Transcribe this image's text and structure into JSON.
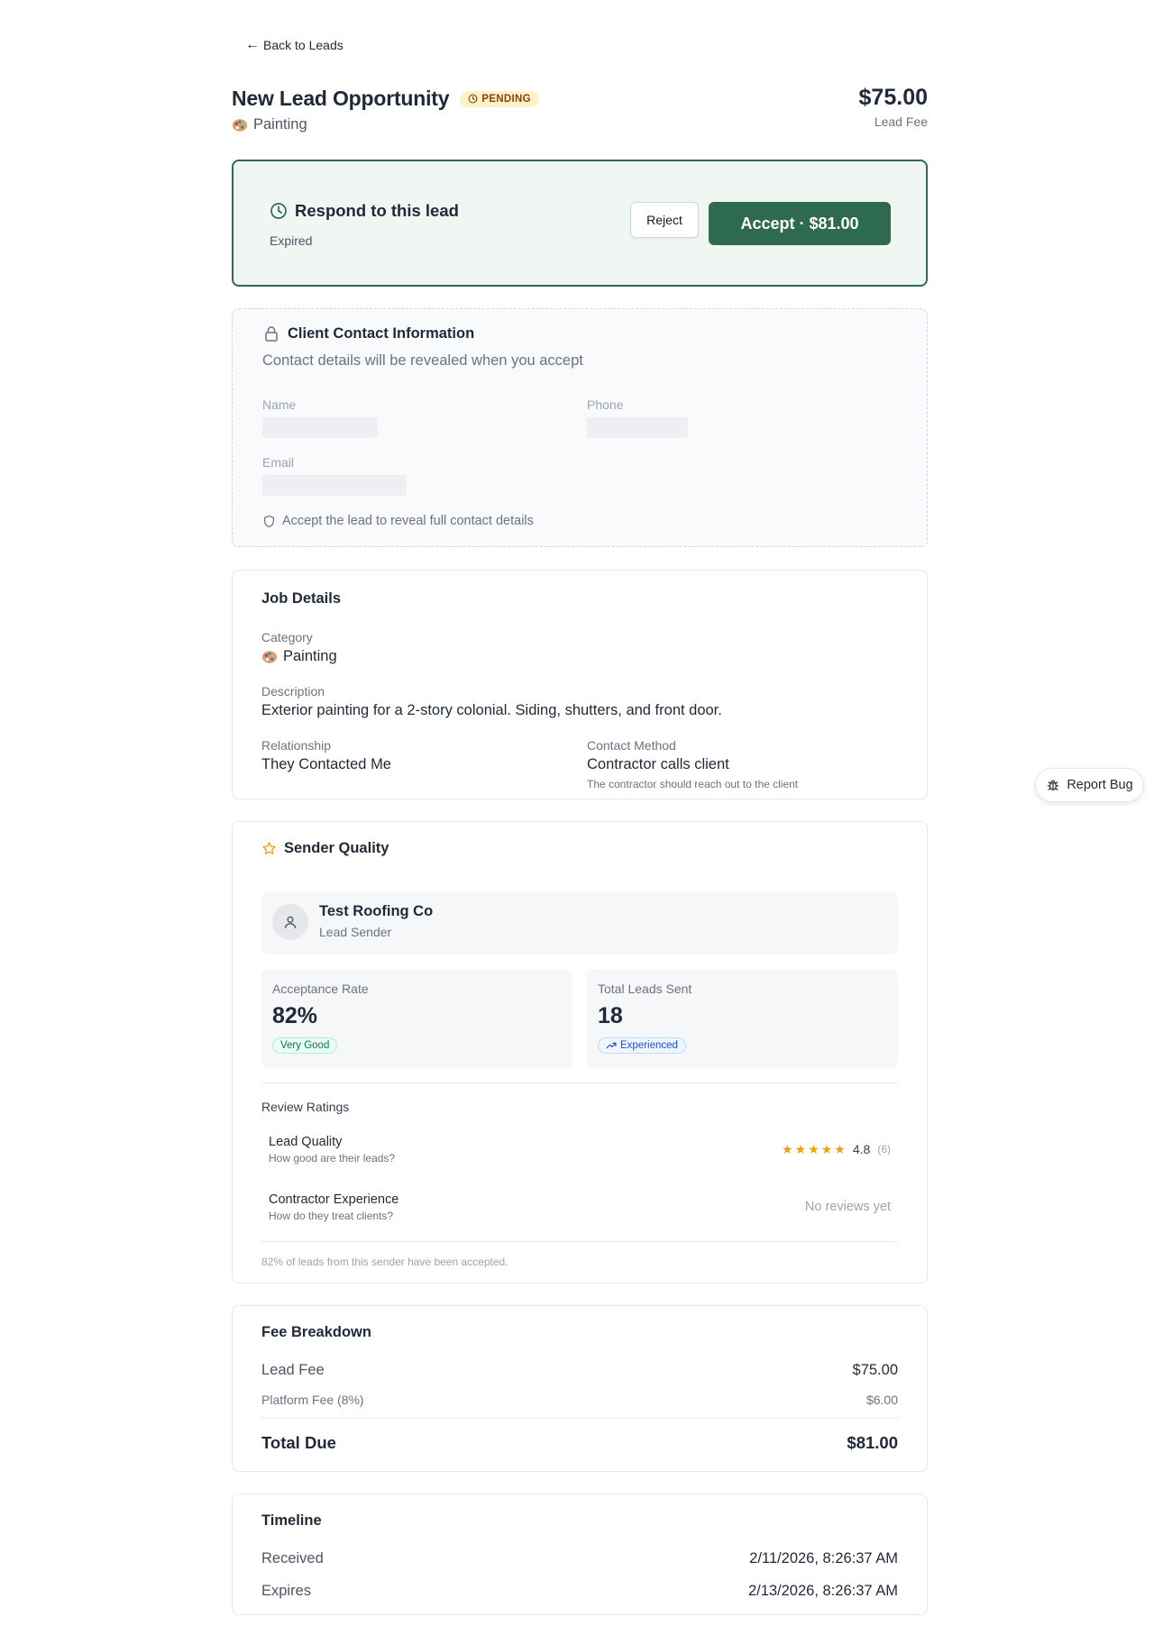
{
  "nav": {
    "back_label": "Back to Leads"
  },
  "header": {
    "title": "New Lead Opportunity",
    "status": "PENDING",
    "category": "Painting",
    "price": "$75.00",
    "price_label": "Lead Fee"
  },
  "respond": {
    "title": "Respond to this lead",
    "status": "Expired",
    "reject_label": "Reject",
    "accept_label": "Accept · $81.00"
  },
  "contact": {
    "title": "Client Contact Information",
    "subtitle": "Contact details will be revealed when you accept",
    "name_label": "Name",
    "phone_label": "Phone",
    "email_label": "Email",
    "note": "Accept the lead to reveal full contact details"
  },
  "job": {
    "title": "Job Details",
    "category_label": "Category",
    "category_value": "Painting",
    "description_label": "Description",
    "description_value": "Exterior painting for a 2-story colonial. Siding, shutters, and front door.",
    "relationship_label": "Relationship",
    "relationship_value": "They Contacted Me",
    "contact_method_label": "Contact Method",
    "contact_method_value": "Contractor calls client",
    "contact_method_note": "The contractor should reach out to the client"
  },
  "quality": {
    "title": "Sender Quality",
    "sender_name": "Test Roofing Co",
    "sender_role": "Lead Sender",
    "acceptance_label": "Acceptance Rate",
    "acceptance_value": "82%",
    "acceptance_badge": "Very Good",
    "total_label": "Total Leads Sent",
    "total_value": "18",
    "total_badge": "Experienced",
    "reviews_title": "Review Ratings",
    "lead_quality_title": "Lead Quality",
    "lead_quality_sub": "How good are their leads?",
    "lead_quality_rating": "4.8",
    "lead_quality_stars": 5,
    "lead_quality_count": "(6)",
    "experience_title": "Contractor Experience",
    "experience_sub": "How do they treat clients?",
    "experience_empty": "No reviews yet",
    "footnote": "82% of leads from this sender have been accepted."
  },
  "fees": {
    "title": "Fee Breakdown",
    "lead_fee_label": "Lead Fee",
    "lead_fee_value": "$75.00",
    "platform_fee_label": "Platform Fee (8%)",
    "platform_fee_value": "$6.00",
    "total_label": "Total Due",
    "total_value": "$81.00"
  },
  "timeline": {
    "title": "Timeline",
    "received_label": "Received",
    "received_value": "2/11/2026, 8:26:37 AM",
    "expires_label": "Expires",
    "expires_value": "2/13/2026, 8:26:37 AM"
  },
  "report_bug": {
    "label": "Report Bug"
  },
  "colors": {
    "accent": "#2d6a4f",
    "badge_pending_bg": "#fef3c7",
    "star": "#f59e0b"
  }
}
